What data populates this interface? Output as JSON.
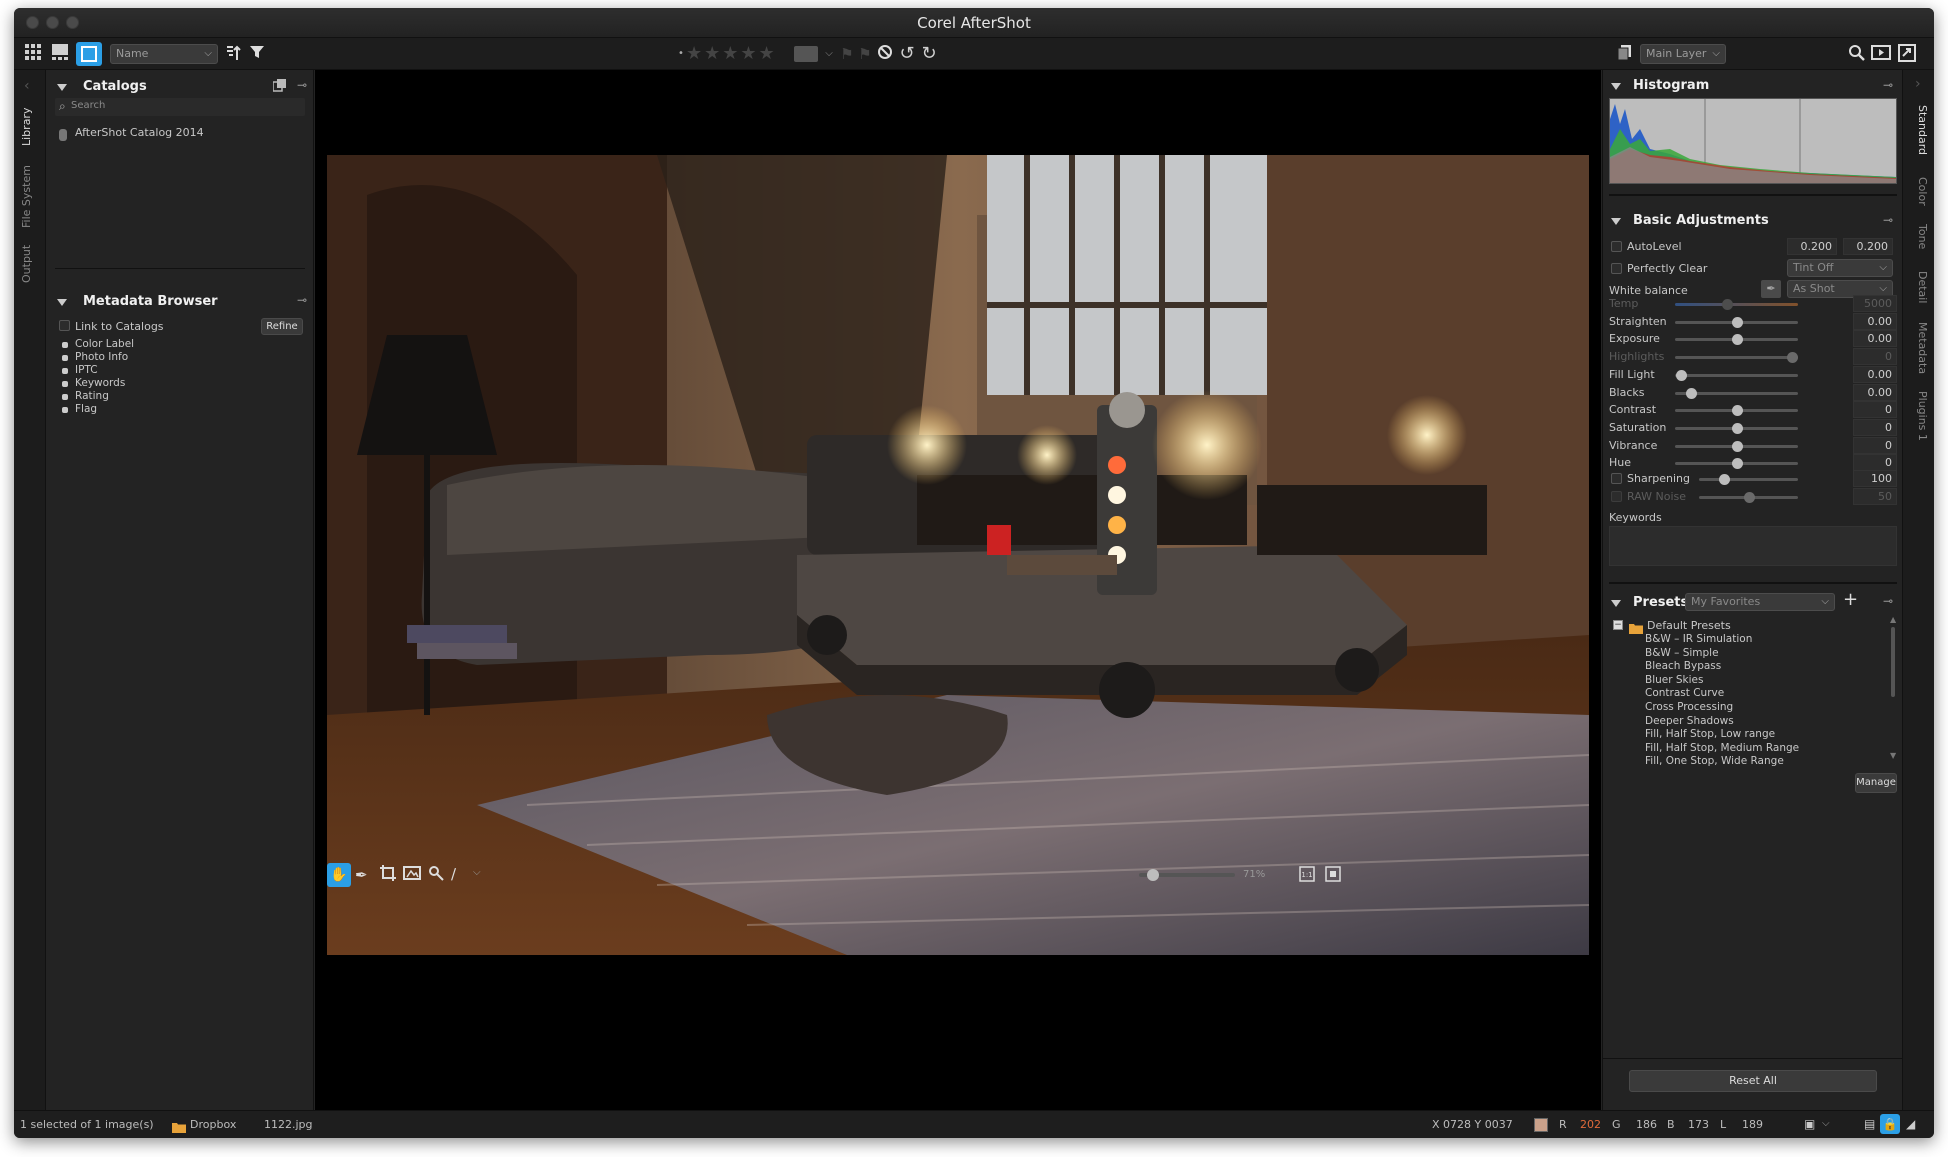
{
  "window": {
    "title": "Corel AfterShot"
  },
  "toolbar": {
    "sort_value": "Name",
    "layer_value": "Main Layer",
    "icons": [
      "grid-view-icon",
      "filmstrip-view-icon",
      "single-view-icon",
      "sort-icon",
      "filter-icon",
      "star-rating-icon",
      "flag-icon",
      "rotate-left-icon",
      "rotate-right-icon",
      "layers-icon",
      "search-icon",
      "slideshow-icon",
      "fullscreen-icon"
    ]
  },
  "left_tabs": [
    "Library",
    "File System",
    "Output"
  ],
  "right_tabs": [
    "Standard",
    "Color",
    "Tone",
    "Detail",
    "Metadata",
    "Plugins 1"
  ],
  "catalogs": {
    "title": "Catalogs",
    "search_placeholder": "Search",
    "items": [
      "AfterShot Catalog 2014"
    ]
  },
  "metadata_browser": {
    "title": "Metadata Browser",
    "link_label": "Link to Catalogs",
    "refine_label": "Refine",
    "items": [
      "Color Label",
      "Photo Info",
      "IPTC",
      "Keywords",
      "Rating",
      "Flag"
    ]
  },
  "viewer": {
    "zoom_label": "71%",
    "zoom_fraction": 0.15
  },
  "histogram": {
    "title": "Histogram"
  },
  "basic": {
    "title": "Basic Adjustments",
    "autolevel": {
      "label": "AutoLevel",
      "v1": "0.200",
      "v2": "0.200"
    },
    "perfectly_clear": {
      "label": "Perfectly Clear",
      "value": "Tint Off"
    },
    "white_balance": {
      "label": "White balance",
      "value": "As Shot"
    },
    "sliders": [
      {
        "label": "Temp",
        "value": "5000",
        "pos": 0.42,
        "disabled": true
      },
      {
        "label": "Straighten",
        "value": "0.00",
        "pos": 0.5,
        "disabled": false
      },
      {
        "label": "Exposure",
        "value": "0.00",
        "pos": 0.5,
        "disabled": false
      },
      {
        "label": "Highlights",
        "value": "0",
        "pos": 0.95,
        "disabled": true
      },
      {
        "label": "Fill Light",
        "value": "0.00",
        "pos": 0.05,
        "disabled": false
      },
      {
        "label": "Blacks",
        "value": "0.00",
        "pos": 0.13,
        "disabled": false
      },
      {
        "label": "Contrast",
        "value": "0",
        "pos": 0.5,
        "disabled": false
      },
      {
        "label": "Saturation",
        "value": "0",
        "pos": 0.5,
        "disabled": false
      },
      {
        "label": "Vibrance",
        "value": "0",
        "pos": 0.5,
        "disabled": false
      },
      {
        "label": "Hue",
        "value": "0",
        "pos": 0.5,
        "disabled": false
      }
    ],
    "sharpening": {
      "label": "Sharpening",
      "value": "100",
      "pos": 0.25
    },
    "raw_noise": {
      "label": "RAW Noise",
      "value": "50",
      "pos": 0.5
    },
    "keywords_label": "Keywords"
  },
  "presets": {
    "title": "Presets",
    "dropdown": "My Favorites",
    "folder": "Default Presets",
    "items": [
      "B&W – IR Simulation",
      "B&W – Simple",
      "Bleach Bypass",
      "Bluer Skies",
      "Contrast Curve",
      "Cross Processing",
      "Deeper Shadows",
      "Fill, Half Stop, Low range",
      "Fill, Half Stop, Medium Range",
      "Fill, One Stop, Wide Range"
    ],
    "manage_label": "Manage"
  },
  "reset_all_label": "Reset All",
  "status": {
    "selection": "1 selected of 1 image(s)",
    "folder": "Dropbox",
    "file": "1122.jpg",
    "coords": "X 0728  Y 0037",
    "r_label": "R",
    "r_value": "202",
    "g_label": "G",
    "g_value": "186",
    "b_label": "B",
    "b_value": "173",
    "l_label": "L",
    "l_value": "189"
  },
  "colors": {
    "accent": "#2b9fe6",
    "swatch": "#caa18a",
    "r_value": "#e06a3a"
  }
}
